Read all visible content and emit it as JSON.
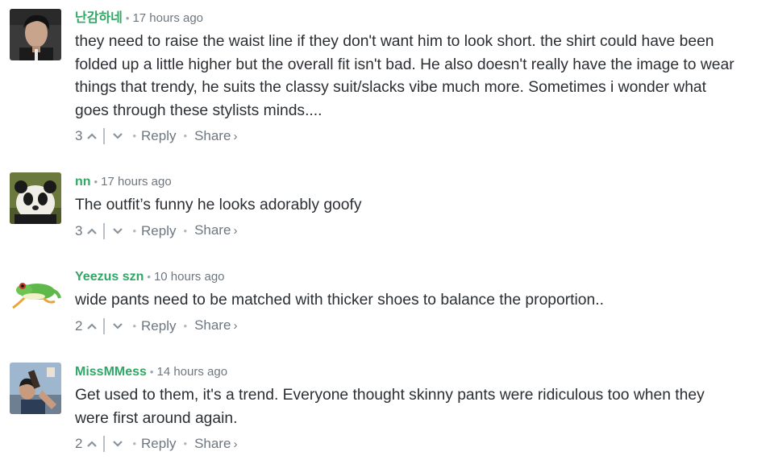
{
  "comments": [
    {
      "author": "난감하네",
      "time": "17 hours ago",
      "lines": [
        "they need to raise the waist line if they don't want him to look short. the shirt could have been",
        "folded up a little higher but the overall fit isn't bad. He also doesn't really have the image to wear",
        "things that trendy, he suits the classy suit/slacks vibe much more. Sometimes i wonder what",
        "goes through these stylists minds...."
      ],
      "votes": "3",
      "reply_label": "Reply",
      "share_label": "Share",
      "share_chevron": "›",
      "avatar": "portrait-photo"
    },
    {
      "author": "nn",
      "time": "17 hours ago",
      "lines": [
        "The outfit’s funny he looks adorably goofy"
      ],
      "votes": "3",
      "reply_label": "Reply",
      "share_label": "Share",
      "share_chevron": "›",
      "avatar": "panda-photo"
    },
    {
      "author": "Yeezus szn",
      "time": "10 hours ago",
      "lines": [
        "wide pants need to be matched with thicker shoes to balance the proportion.."
      ],
      "votes": "2",
      "reply_label": "Reply",
      "share_label": "Share",
      "share_chevron": "›",
      "avatar": "frog-photo"
    },
    {
      "author": "MissMMess",
      "time": "14 hours ago",
      "lines": [
        "Get used to them, it's a trend. Everyone thought skinny pants were ridiculous too when they",
        "were first around again."
      ],
      "votes": "2",
      "reply_label": "Reply",
      "share_label": "Share",
      "share_chevron": "›",
      "avatar": "person-photo"
    }
  ],
  "colors": {
    "author": "#2ea864",
    "meta": "#6e7780",
    "text": "#2b2f33"
  },
  "icons": {
    "upvote": "chevron-up-icon",
    "downvote": "chevron-down-icon"
  }
}
